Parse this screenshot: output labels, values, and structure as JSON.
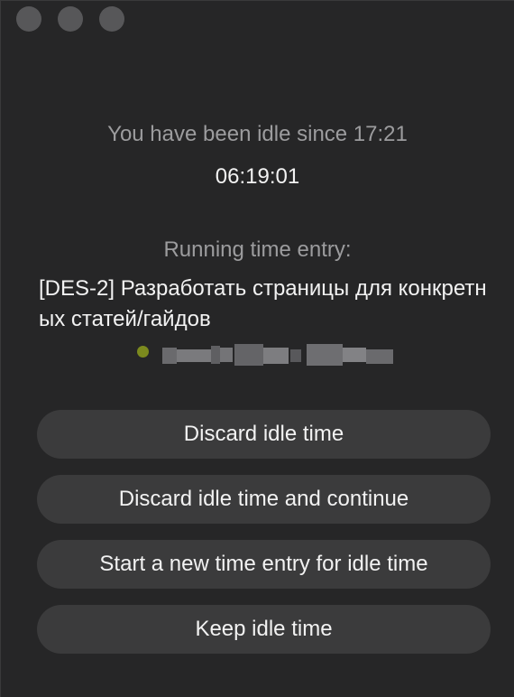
{
  "window": {
    "controls": [
      "close",
      "minimize",
      "zoom"
    ],
    "control_color": "#575759"
  },
  "idle": {
    "since_text": "You have been idle since 17:21",
    "duration": "06:19:01"
  },
  "running": {
    "label": "Running time entry:",
    "entry_title": "[DES-2] Разработать страницы для конкретных статей/гайдов",
    "project_color": "#7c8a1e"
  },
  "actions": {
    "discard": "Discard idle time",
    "discard_continue": "Discard idle time and continue",
    "start_new": "Start a new time entry for idle time",
    "keep": "Keep idle time"
  }
}
